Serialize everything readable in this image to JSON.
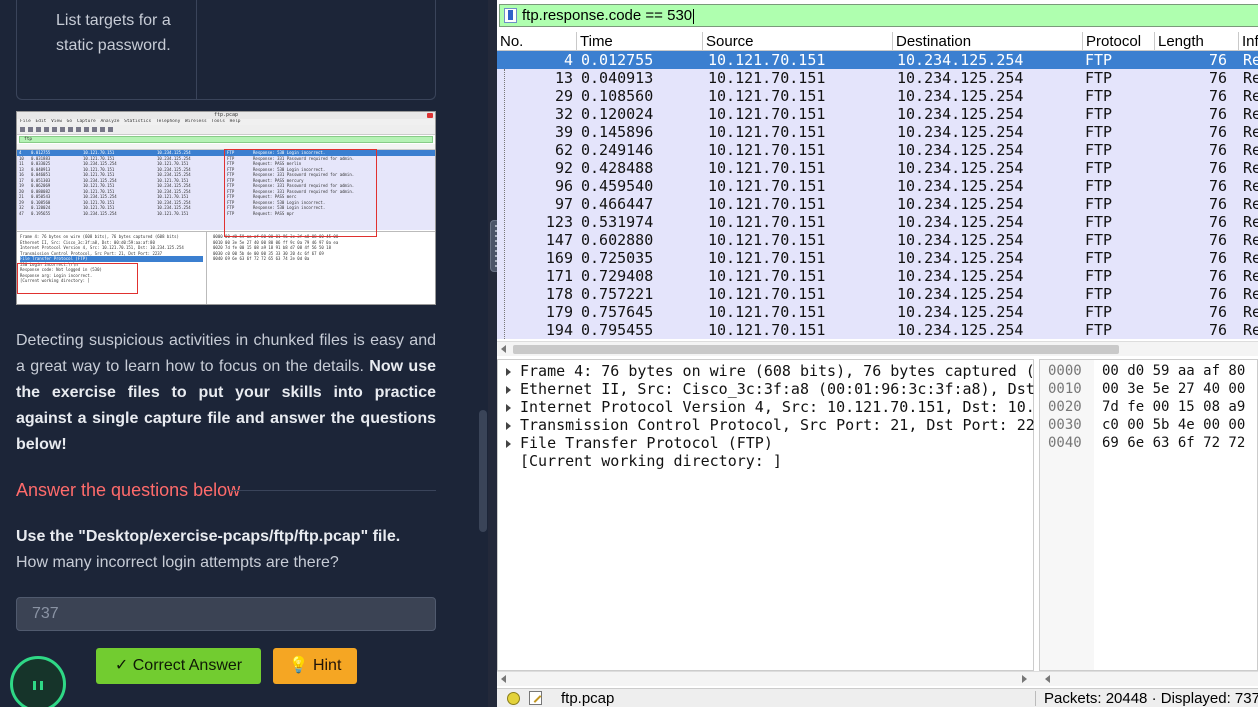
{
  "task": {
    "text": "List targets for a static password."
  },
  "thumbnail": {
    "title": "ftp.pcap",
    "menu": "File Edit View Go Capture Analyze Statistics Telephony Wireless Tools Help",
    "filter": "ftp",
    "rows": [
      {
        "no": "4",
        "time": "0.012755",
        "src": "10.121.70.151",
        "dst": "10.234.125.254",
        "proto": "FTP",
        "info": "Response: 530 Login incorrect."
      },
      {
        "no": "10",
        "time": "0.031883",
        "src": "10.121.70.151",
        "dst": "10.234.125.254",
        "proto": "FTP",
        "info": "Response: 331 Password required for admin."
      },
      {
        "no": "11",
        "time": "0.033025",
        "src": "10.234.125.254",
        "dst": "10.121.70.151",
        "proto": "FTP",
        "info": "Request: PASS merlin"
      },
      {
        "no": "13",
        "time": "0.040913",
        "src": "10.121.70.151",
        "dst": "10.234.125.254",
        "proto": "FTP",
        "info": "Response: 530 Login incorrect."
      },
      {
        "no": "16",
        "time": "0.046051",
        "src": "10.121.70.151",
        "dst": "10.234.125.254",
        "proto": "FTP",
        "info": "Response: 331 Password required for admin."
      },
      {
        "no": "17",
        "time": "0.051303",
        "src": "10.234.125.254",
        "dst": "10.121.70.151",
        "proto": "FTP",
        "info": "Request: PASS mercury"
      },
      {
        "no": "19",
        "time": "0.062069",
        "src": "10.121.70.151",
        "dst": "10.234.125.254",
        "proto": "FTP",
        "info": "Response: 331 Password required for admin."
      },
      {
        "no": "20",
        "time": "0.080082",
        "src": "10.121.70.151",
        "dst": "10.234.125.254",
        "proto": "FTP",
        "info": "Response: 331 Password required for admin."
      },
      {
        "no": "21",
        "time": "0.050543",
        "src": "10.234.125.254",
        "dst": "10.121.70.151",
        "proto": "FTP",
        "info": "Request: PASS merc"
      },
      {
        "no": "29",
        "time": "0.108560",
        "src": "10.121.70.151",
        "dst": "10.234.125.254",
        "proto": "FTP",
        "info": "Response: 530 Login incorrect."
      },
      {
        "no": "32",
        "time": "0.120024",
        "src": "10.121.70.151",
        "dst": "10.234.125.254",
        "proto": "FTP",
        "info": "Response: 530 Login incorrect."
      },
      {
        "no": "47",
        "time": "0.195655",
        "src": "10.234.125.254",
        "dst": "10.121.70.151",
        "proto": "FTP",
        "info": "Request: PASS mpr"
      }
    ],
    "detail": [
      "Frame 4: 76 bytes on wire (608 bits), 76 bytes captured (608 bits)",
      "Ethernet II, Src: Cisco_3c:3f:a8, Dst: 00:d0:59:aa:af:80",
      "Internet Protocol Version 4, Src: 10.121.70.151, Dst: 10.234.125.254",
      "Transmission Control Protocol, Src Port: 21, Dst Port: 2237",
      "File Transfer Protocol (FTP)",
      "  530 Login incorrect.\\r\\n",
      "    Response code: Not logged in (530)",
      "    Response arg: Login incorrect.",
      "[Current working directory: ]"
    ],
    "hex": [
      "0000  00 d0 59 aa af 80 00 01  96 3c 3f a8 08 00 45 00",
      "0010  00 3e 5e 27 40 00 80 06  ff 9c 0a 79 46 97 0a ea",
      "0020  7d fe 00 15 08 a9 18 91  b8 d7 08 4f 56 50 18",
      "0030  c0 00 5b 4e 00 00 35 33  30 20 4c 6f 67 69",
      "0040  69 6e 63 6f 72 72 65 63  74 2e 0d 0a"
    ]
  },
  "intro": {
    "plain": "Detecting suspicious activities in chunked files is easy and a great way to learn how to focus on the details.",
    "bold": "Now use the exercise files to put your skills into practice against a single capture file and answer the questions below!"
  },
  "questions": {
    "heading": "Answer the questions below",
    "file_line": "Use the \"Desktop/exercise-pcaps/ftp/ftp.pcap\" file.",
    "question": "How many incorrect login attempts are there?",
    "answer": "737",
    "correct_label": "✓ Correct Answer",
    "hint_label": "💡 Hint"
  },
  "wireshark": {
    "filter": "ftp.response.code == 530",
    "columns": [
      "No.",
      "Time",
      "Source",
      "Destination",
      "Protocol",
      "Length",
      "Info"
    ],
    "packets": [
      {
        "no": "4",
        "time": "0.012755",
        "src": "10.121.70.151",
        "dst": "10.234.125.254",
        "proto": "FTP",
        "len": "76",
        "info": "Re"
      },
      {
        "no": "13",
        "time": "0.040913",
        "src": "10.121.70.151",
        "dst": "10.234.125.254",
        "proto": "FTP",
        "len": "76",
        "info": "Re"
      },
      {
        "no": "29",
        "time": "0.108560",
        "src": "10.121.70.151",
        "dst": "10.234.125.254",
        "proto": "FTP",
        "len": "76",
        "info": "Re"
      },
      {
        "no": "32",
        "time": "0.120024",
        "src": "10.121.70.151",
        "dst": "10.234.125.254",
        "proto": "FTP",
        "len": "76",
        "info": "Re"
      },
      {
        "no": "39",
        "time": "0.145896",
        "src": "10.121.70.151",
        "dst": "10.234.125.254",
        "proto": "FTP",
        "len": "76",
        "info": "Re"
      },
      {
        "no": "62",
        "time": "0.249146",
        "src": "10.121.70.151",
        "dst": "10.234.125.254",
        "proto": "FTP",
        "len": "76",
        "info": "Re"
      },
      {
        "no": "92",
        "time": "0.428488",
        "src": "10.121.70.151",
        "dst": "10.234.125.254",
        "proto": "FTP",
        "len": "76",
        "info": "Re"
      },
      {
        "no": "96",
        "time": "0.459540",
        "src": "10.121.70.151",
        "dst": "10.234.125.254",
        "proto": "FTP",
        "len": "76",
        "info": "Re"
      },
      {
        "no": "97",
        "time": "0.466447",
        "src": "10.121.70.151",
        "dst": "10.234.125.254",
        "proto": "FTP",
        "len": "76",
        "info": "Re"
      },
      {
        "no": "123",
        "time": "0.531974",
        "src": "10.121.70.151",
        "dst": "10.234.125.254",
        "proto": "FTP",
        "len": "76",
        "info": "Re"
      },
      {
        "no": "147",
        "time": "0.602880",
        "src": "10.121.70.151",
        "dst": "10.234.125.254",
        "proto": "FTP",
        "len": "76",
        "info": "Re"
      },
      {
        "no": "169",
        "time": "0.725035",
        "src": "10.121.70.151",
        "dst": "10.234.125.254",
        "proto": "FTP",
        "len": "76",
        "info": "Re"
      },
      {
        "no": "171",
        "time": "0.729408",
        "src": "10.121.70.151",
        "dst": "10.234.125.254",
        "proto": "FTP",
        "len": "76",
        "info": "Re"
      },
      {
        "no": "178",
        "time": "0.757221",
        "src": "10.121.70.151",
        "dst": "10.234.125.254",
        "proto": "FTP",
        "len": "76",
        "info": "Re"
      },
      {
        "no": "179",
        "time": "0.757645",
        "src": "10.121.70.151",
        "dst": "10.234.125.254",
        "proto": "FTP",
        "len": "76",
        "info": "Re"
      },
      {
        "no": "194",
        "time": "0.795455",
        "src": "10.121.70.151",
        "dst": "10.234.125.254",
        "proto": "FTP",
        "len": "76",
        "info": "Re"
      }
    ],
    "details": [
      {
        "label": "Frame 4: 76 bytes on wire (608 bits), 76 bytes captured (",
        "expand": true
      },
      {
        "label": "Ethernet II, Src: Cisco_3c:3f:a8 (00:01:96:3c:3f:a8), Dst",
        "expand": true
      },
      {
        "label": "Internet Protocol Version 4, Src: 10.121.70.151, Dst: 10.",
        "expand": true
      },
      {
        "label": "Transmission Control Protocol, Src Port: 21, Dst Port: 22",
        "expand": true
      },
      {
        "label": "File Transfer Protocol (FTP)",
        "expand": true
      },
      {
        "label": "[Current working directory: ]",
        "expand": false
      }
    ],
    "bytes": [
      {
        "off": "0000",
        "hex": "00 d0 59 aa af 80"
      },
      {
        "off": "0010",
        "hex": "00 3e 5e 27 40 00"
      },
      {
        "off": "0020",
        "hex": "7d fe 00 15 08 a9"
      },
      {
        "off": "0030",
        "hex": "c0 00 5b 4e 00 00"
      },
      {
        "off": "0040",
        "hex": "69 6e 63 6f 72 72"
      }
    ],
    "status": {
      "file": "ftp.pcap",
      "packets": "Packets: 20448 · Displayed: 737"
    }
  }
}
